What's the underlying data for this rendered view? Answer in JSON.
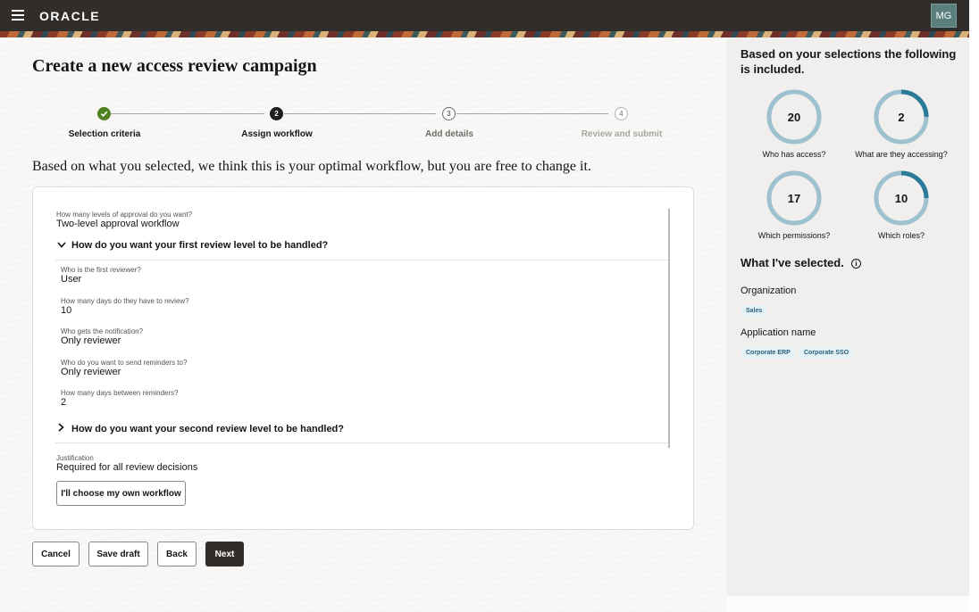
{
  "header": {
    "logo": "ORACLE",
    "avatar_initials": "MG"
  },
  "page": {
    "title": "Create a new access review campaign",
    "subtitle": "Based on what you selected, we think this is your optimal workflow, but you are free to change it."
  },
  "steps": [
    {
      "number": "",
      "label": "Selection criteria",
      "state": "done"
    },
    {
      "number": "2",
      "label": "Assign workflow",
      "state": "current"
    },
    {
      "number": "3",
      "label": "Add details",
      "state": "upcoming"
    },
    {
      "number": "4",
      "label": "Review and submit",
      "state": "disabled"
    }
  ],
  "form": {
    "levels": {
      "label": "How many levels of approval do you want?",
      "value": "Two-level approval workflow"
    },
    "first_section_title": "How do you want your first review level to be handled?",
    "first_reviewer": {
      "label": "Who is the first reviewer?",
      "value": "User"
    },
    "days_review": {
      "label": "How many days do they have to review?",
      "value": "10"
    },
    "notification": {
      "label": "Who gets the notification?",
      "value": "Only reviewer"
    },
    "reminders_to": {
      "label": "Who do you want to send reminders to?",
      "value": "Only reviewer"
    },
    "days_between": {
      "label": "How many days between reminders?",
      "value": "2"
    },
    "second_section_title": "How do you want your second review level to be handled?",
    "justification": {
      "label": "Justification",
      "value": "Required for all review decisions"
    },
    "own_workflow_button": "I'll choose my own workflow"
  },
  "actions": {
    "cancel": "Cancel",
    "save_draft": "Save draft",
    "back": "Back",
    "next": "Next"
  },
  "summary": {
    "heading": "Based on your selections the following is included.",
    "metrics": [
      {
        "value": "20",
        "caption": "Who has access?",
        "fill": 0.0
      },
      {
        "value": "2",
        "caption": "What are they accessing?",
        "fill": 0.25
      },
      {
        "value": "17",
        "caption": "Which permissions?",
        "fill": 0.0
      },
      {
        "value": "10",
        "caption": "Which roles?",
        "fill": 0.25
      }
    ],
    "selected_heading": "What I've selected.",
    "info_icon": "i",
    "groups": [
      {
        "label": "Organization",
        "chips": [
          "Sales"
        ]
      },
      {
        "label": "Application name",
        "chips": [
          "Corporate ERP",
          "Corporate SSO"
        ]
      }
    ]
  },
  "colors": {
    "donut_track": "#9ec1cf",
    "donut_fill": "#2b7a99",
    "header_bg": "#312d2a",
    "done_green": "#508223"
  }
}
